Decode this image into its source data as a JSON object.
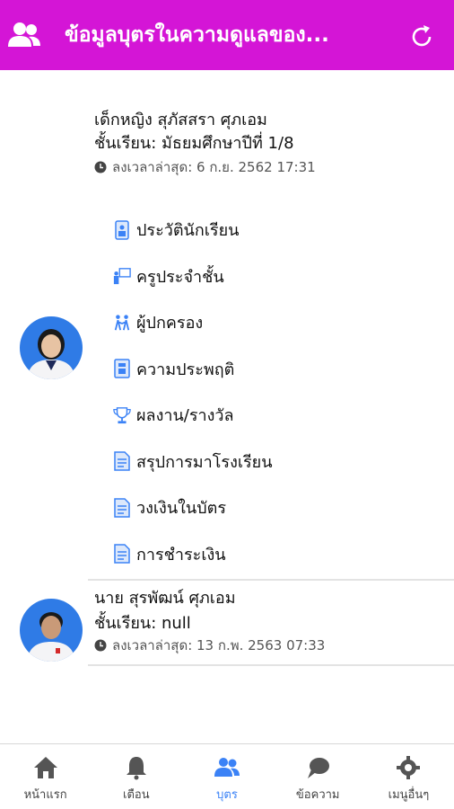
{
  "colors": {
    "appbar": "#d415d6",
    "active_tab": "#3b82f6",
    "menu_icon": "#3b82f6"
  },
  "header": {
    "title": "ข้อมูลบุตรในความดูแลของ...",
    "left_icon": "users-icon",
    "right_icon": "refresh-icon"
  },
  "children": [
    {
      "name": "เด็กหญิง สุภัสสรา ศุภเอม",
      "grade": "ชั้นเรียน: มัธยมศึกษาปีที่ 1/8",
      "last_update": "ลงเวลาล่าสุด: 6 ก.ย. 2562 17:31",
      "menu": [
        {
          "label": "ประวัตินักเรียน",
          "icon": "student-record-icon"
        },
        {
          "label": "ครูประจำชั้น",
          "icon": "teacher-icon"
        },
        {
          "label": "ผู้ปกครอง",
          "icon": "guardian-icon"
        },
        {
          "label": "ความประพฤติ",
          "icon": "behavior-icon"
        },
        {
          "label": "ผลงาน/รางวัล",
          "icon": "trophy-icon"
        },
        {
          "label": "สรุปการมาโรงเรียน",
          "icon": "attendance-doc-icon"
        },
        {
          "label": "วงเงินในบัตร",
          "icon": "card-balance-doc-icon"
        },
        {
          "label": "การชำระเงิน",
          "icon": "payment-doc-icon"
        }
      ]
    },
    {
      "name": "นาย สุรพัฒน์ ศุภเอม",
      "grade": "ชั้นเรียน: null",
      "last_update": "ลงเวลาล่าสุด: 13 ก.พ. 2563 07:33"
    }
  ],
  "nav": [
    {
      "label": "หน้าแรก",
      "icon": "home-icon"
    },
    {
      "label": "เตือน",
      "icon": "bell-icon"
    },
    {
      "label": "บุตร",
      "icon": "children-icon",
      "active": true
    },
    {
      "label": "ข้อความ",
      "icon": "chat-icon"
    },
    {
      "label": "เมนูอื่นๆ",
      "icon": "gear-icon"
    }
  ]
}
